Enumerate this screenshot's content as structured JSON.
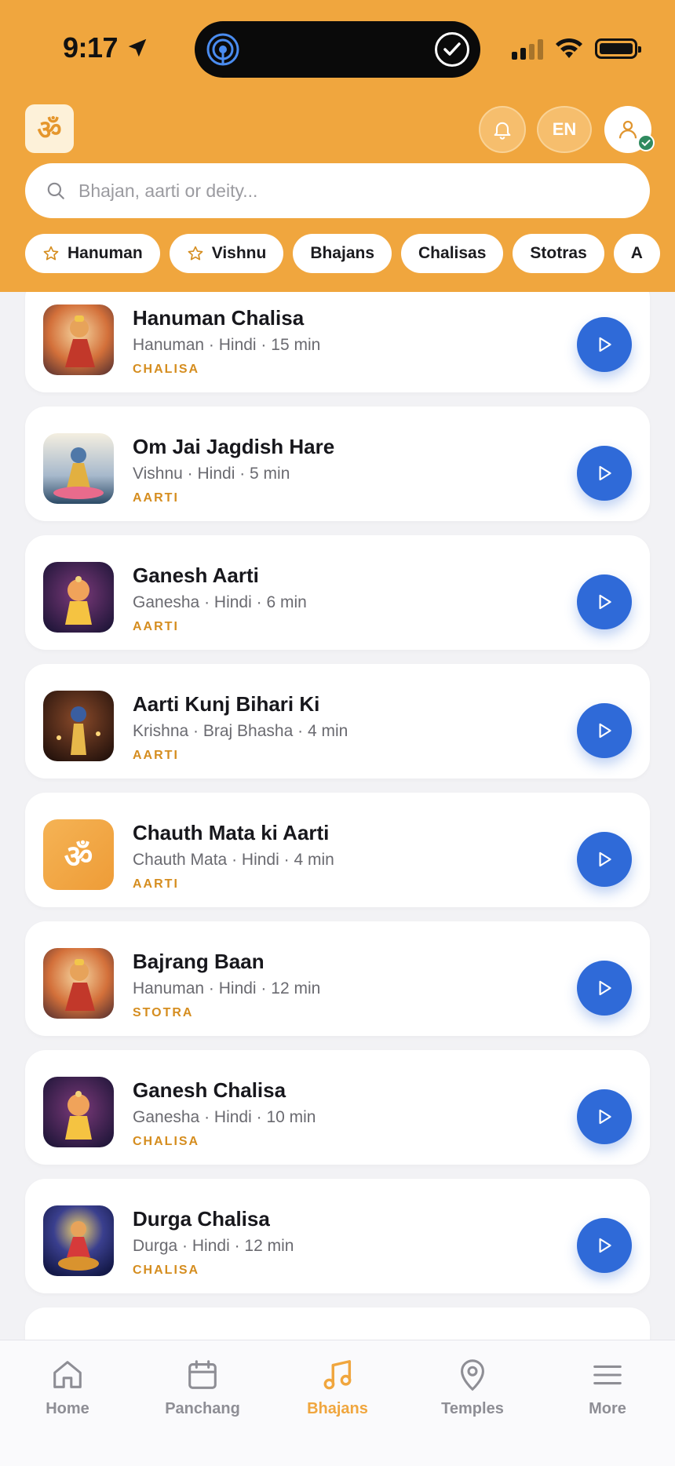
{
  "status_bar": {
    "time": "9:17"
  },
  "header": {
    "logo": "ॐ",
    "language": "EN",
    "search_placeholder": "Bhajan, aarti or deity..."
  },
  "chips": [
    {
      "label": "Hanuman",
      "starred": true
    },
    {
      "label": "Vishnu",
      "starred": true
    },
    {
      "label": "Bhajans",
      "starred": false
    },
    {
      "label": "Chalisas",
      "starred": false
    },
    {
      "label": "Stotras",
      "starred": false
    },
    {
      "label": "A",
      "starred": false
    }
  ],
  "items": [
    {
      "title": "Hanuman Chalisa",
      "deity": "Hanuman",
      "language": "Hindi",
      "duration": "15 min",
      "category": "CHALISA",
      "sep": " · "
    },
    {
      "title": "Om Jai Jagdish Hare",
      "deity": "Vishnu",
      "language": "Hindi",
      "duration": "5 min",
      "category": "AARTI",
      "sep": " · "
    },
    {
      "title": "Ganesh Aarti",
      "deity": "Ganesha",
      "language": "Hindi",
      "duration": "6 min",
      "category": "AARTI",
      "sep": " · "
    },
    {
      "title": "Aarti Kunj Bihari Ki",
      "deity": "Krishna",
      "language": "Braj Bhasha",
      "duration": "4 min",
      "category": "AARTI",
      "sep": " · "
    },
    {
      "title": "Chauth Mata ki Aarti",
      "deity": "Chauth Mata",
      "language": "Hindi",
      "duration": "4 min",
      "category": "AARTI",
      "sep": " · "
    },
    {
      "title": "Bajrang Baan",
      "deity": "Hanuman",
      "language": "Hindi",
      "duration": "12 min",
      "category": "STOTRA",
      "sep": " · "
    },
    {
      "title": "Ganesh Chalisa",
      "deity": "Ganesha",
      "language": "Hindi",
      "duration": "10 min",
      "category": "CHALISA",
      "sep": " · "
    },
    {
      "title": "Durga Chalisa",
      "deity": "Durga",
      "language": "Hindi",
      "duration": "12 min",
      "category": "CHALISA",
      "sep": " · "
    }
  ],
  "tabs": [
    {
      "label": "Home",
      "icon": "home-icon"
    },
    {
      "label": "Panchang",
      "icon": "calendar-icon"
    },
    {
      "label": "Bhajans",
      "icon": "music-note-icon"
    },
    {
      "label": "Temples",
      "icon": "map-pin-icon"
    },
    {
      "label": "More",
      "icon": "menu-icon"
    }
  ],
  "colors": {
    "accent": "#f0a63e",
    "play": "#2f6ad8",
    "category": "#d58d1f"
  }
}
